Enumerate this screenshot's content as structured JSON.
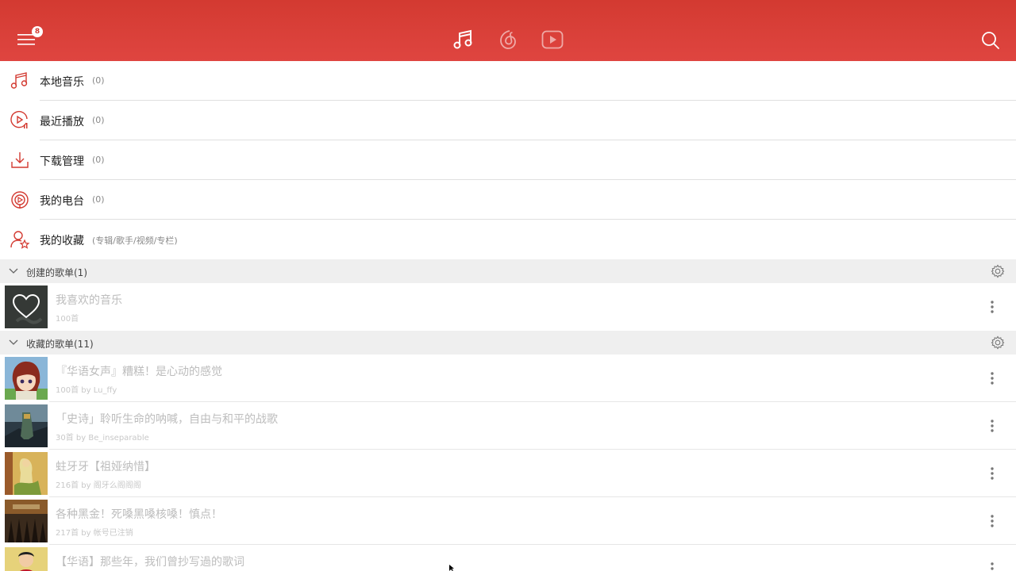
{
  "colors": {
    "brand": "#d33a31",
    "icon_accent": "#d33a31"
  },
  "topbar": {
    "menu_badge": "8",
    "tabs": [
      {
        "icon": "music-note-icon",
        "active": true
      },
      {
        "icon": "netease-cloud-icon",
        "active": false
      },
      {
        "icon": "video-play-icon",
        "active": false
      }
    ],
    "search_icon": "search-icon"
  },
  "entries": [
    {
      "label": "本地音乐",
      "count": "(0)",
      "icon": "music-note-icon"
    },
    {
      "label": "最近播放",
      "count": "(0)",
      "icon": "recent-play-icon"
    },
    {
      "label": "下载管理",
      "count": "(0)",
      "icon": "download-icon"
    },
    {
      "label": "我的电台",
      "count": "(0)",
      "icon": "radio-icon"
    },
    {
      "label": "我的收藏",
      "count": "(专辑/歌手/视频/专栏)",
      "icon": "favorite-user-icon"
    }
  ],
  "created_section": {
    "label": "创建的歌单(1)",
    "playlists": [
      {
        "title": "我喜欢的音乐",
        "subtitle": "100首"
      }
    ]
  },
  "collected_section": {
    "label": "收藏的歌单(11)",
    "playlists": [
      {
        "title": "『华语女声』糟糕！是心动的感觉",
        "subtitle": "100首 by Lu_ffy"
      },
      {
        "title": "「史诗」聆听生命的呐喊，自由与和平的战歌",
        "subtitle": "30首 by Be_inseparable"
      },
      {
        "title": "蛀牙牙【祖娅纳惜】",
        "subtitle": "216首 by 阁牙么阁阁阁"
      },
      {
        "title": "各种黑金！死嗓黑嗓核嗓！慎点！",
        "subtitle": "217首 by 帐号已注销"
      },
      {
        "title": "【华语】那些年，我们曾抄写過的歌词",
        "subtitle": ""
      }
    ]
  }
}
